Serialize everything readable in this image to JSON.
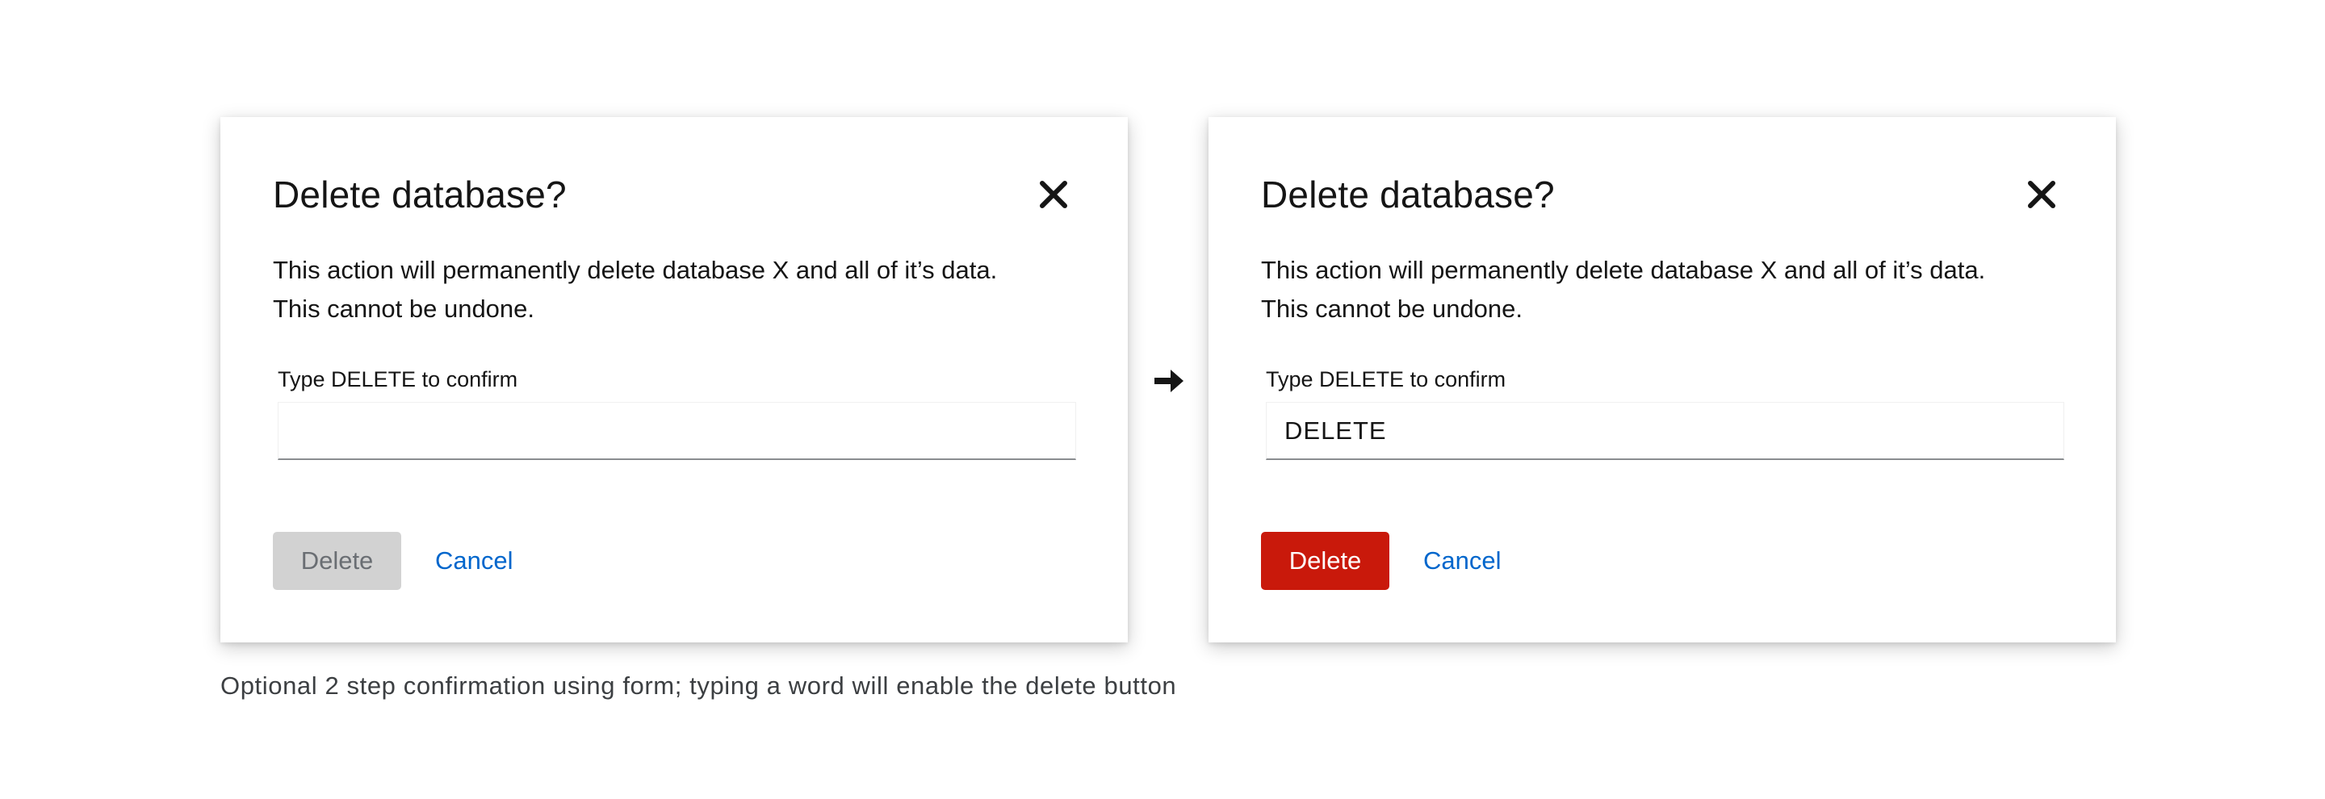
{
  "modal_before": {
    "title": "Delete database?",
    "body_line_1": "This action will permanently delete database X and all of it’s data.",
    "body_line_2": "This cannot be undone.",
    "field_label": "Type DELETE to confirm",
    "input_value": "",
    "delete_label": "Delete",
    "delete_state": "disabled",
    "cancel_label": "Cancel",
    "close_icon": "close-icon"
  },
  "modal_after": {
    "title": "Delete database?",
    "body_line_1": "This action will permanently delete database X and all of it’s data.",
    "body_line_2": "This cannot be undone.",
    "field_label": "Type DELETE to confirm",
    "input_value": "DELETE",
    "delete_label": "Delete",
    "delete_state": "enabled",
    "cancel_label": "Cancel",
    "close_icon": "close-icon"
  },
  "transition_icon": "arrow-right-icon",
  "caption": "Optional 2 step confirmation using form; typing a word will enable the delete button",
  "colors": {
    "danger": "#c9190b",
    "disabled_bg": "#d2d2d2",
    "disabled_text": "#6a6e73",
    "link": "#0066cc",
    "text": "#151515"
  }
}
